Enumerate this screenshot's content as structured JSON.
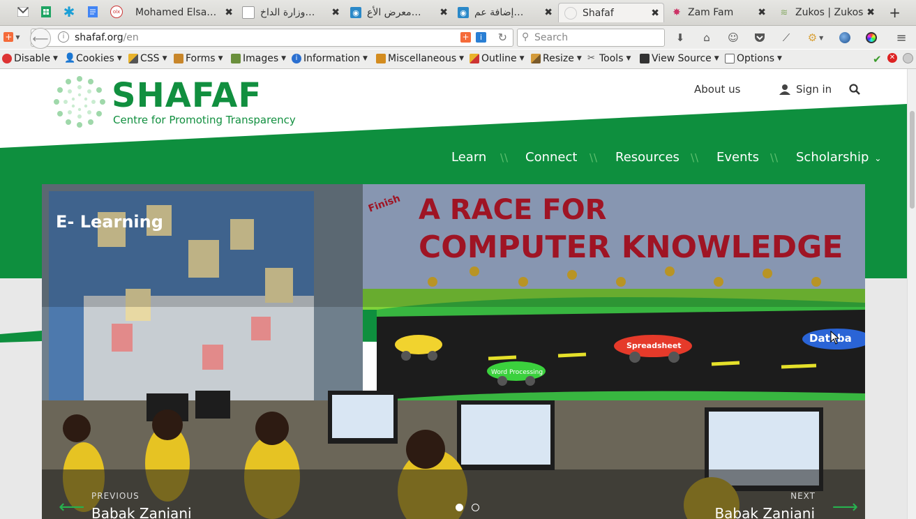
{
  "browser": {
    "tabs": [
      {
        "title": "Mohamed Elsa…",
        "active": false
      },
      {
        "title": "…وزارة الداخ",
        "active": false
      },
      {
        "title": "…معرض الأع",
        "active": false
      },
      {
        "title": "…إضافة عم",
        "active": false
      },
      {
        "title": "Shafaf",
        "active": true
      },
      {
        "title": "Zam Fam",
        "active": false
      },
      {
        "title": "Zukos | Zukos",
        "active": false
      }
    ],
    "new_tab": "+",
    "url_host": "shafaf.org",
    "url_path": "/en",
    "search_placeholder": "Search"
  },
  "devtoolbar": {
    "items": [
      "Disable",
      "Cookies",
      "CSS",
      "Forms",
      "Images",
      "Information",
      "Miscellaneous",
      "Outline",
      "Resize",
      "Tools",
      "View Source",
      "Options"
    ]
  },
  "site": {
    "logo_title": "SHAFAF",
    "logo_subtitle": "Centre for Promoting Transparency",
    "about": "About us",
    "signin": "Sign in",
    "nav": [
      "Learn",
      "Connect",
      "Resources",
      "Events",
      "Scholarship"
    ],
    "nav_separator": "\\\\",
    "slide": {
      "title": "E- Learning",
      "banner_line1": "A RACE FOR",
      "banner_line2": "COMPUTER KNOWLEDGE",
      "finish_label": "Finish",
      "car_labels": [
        "Spreadsheet",
        "Word Processing",
        "Databa"
      ],
      "prev_label": "PREVIOUS",
      "prev_name": "Babak Zaniani",
      "next_label": "NEXT",
      "next_name": "Babak Zaniani",
      "active_dot": 1
    }
  },
  "colors": {
    "brand_green": "#118f3f",
    "accent_green": "#27b14f"
  }
}
